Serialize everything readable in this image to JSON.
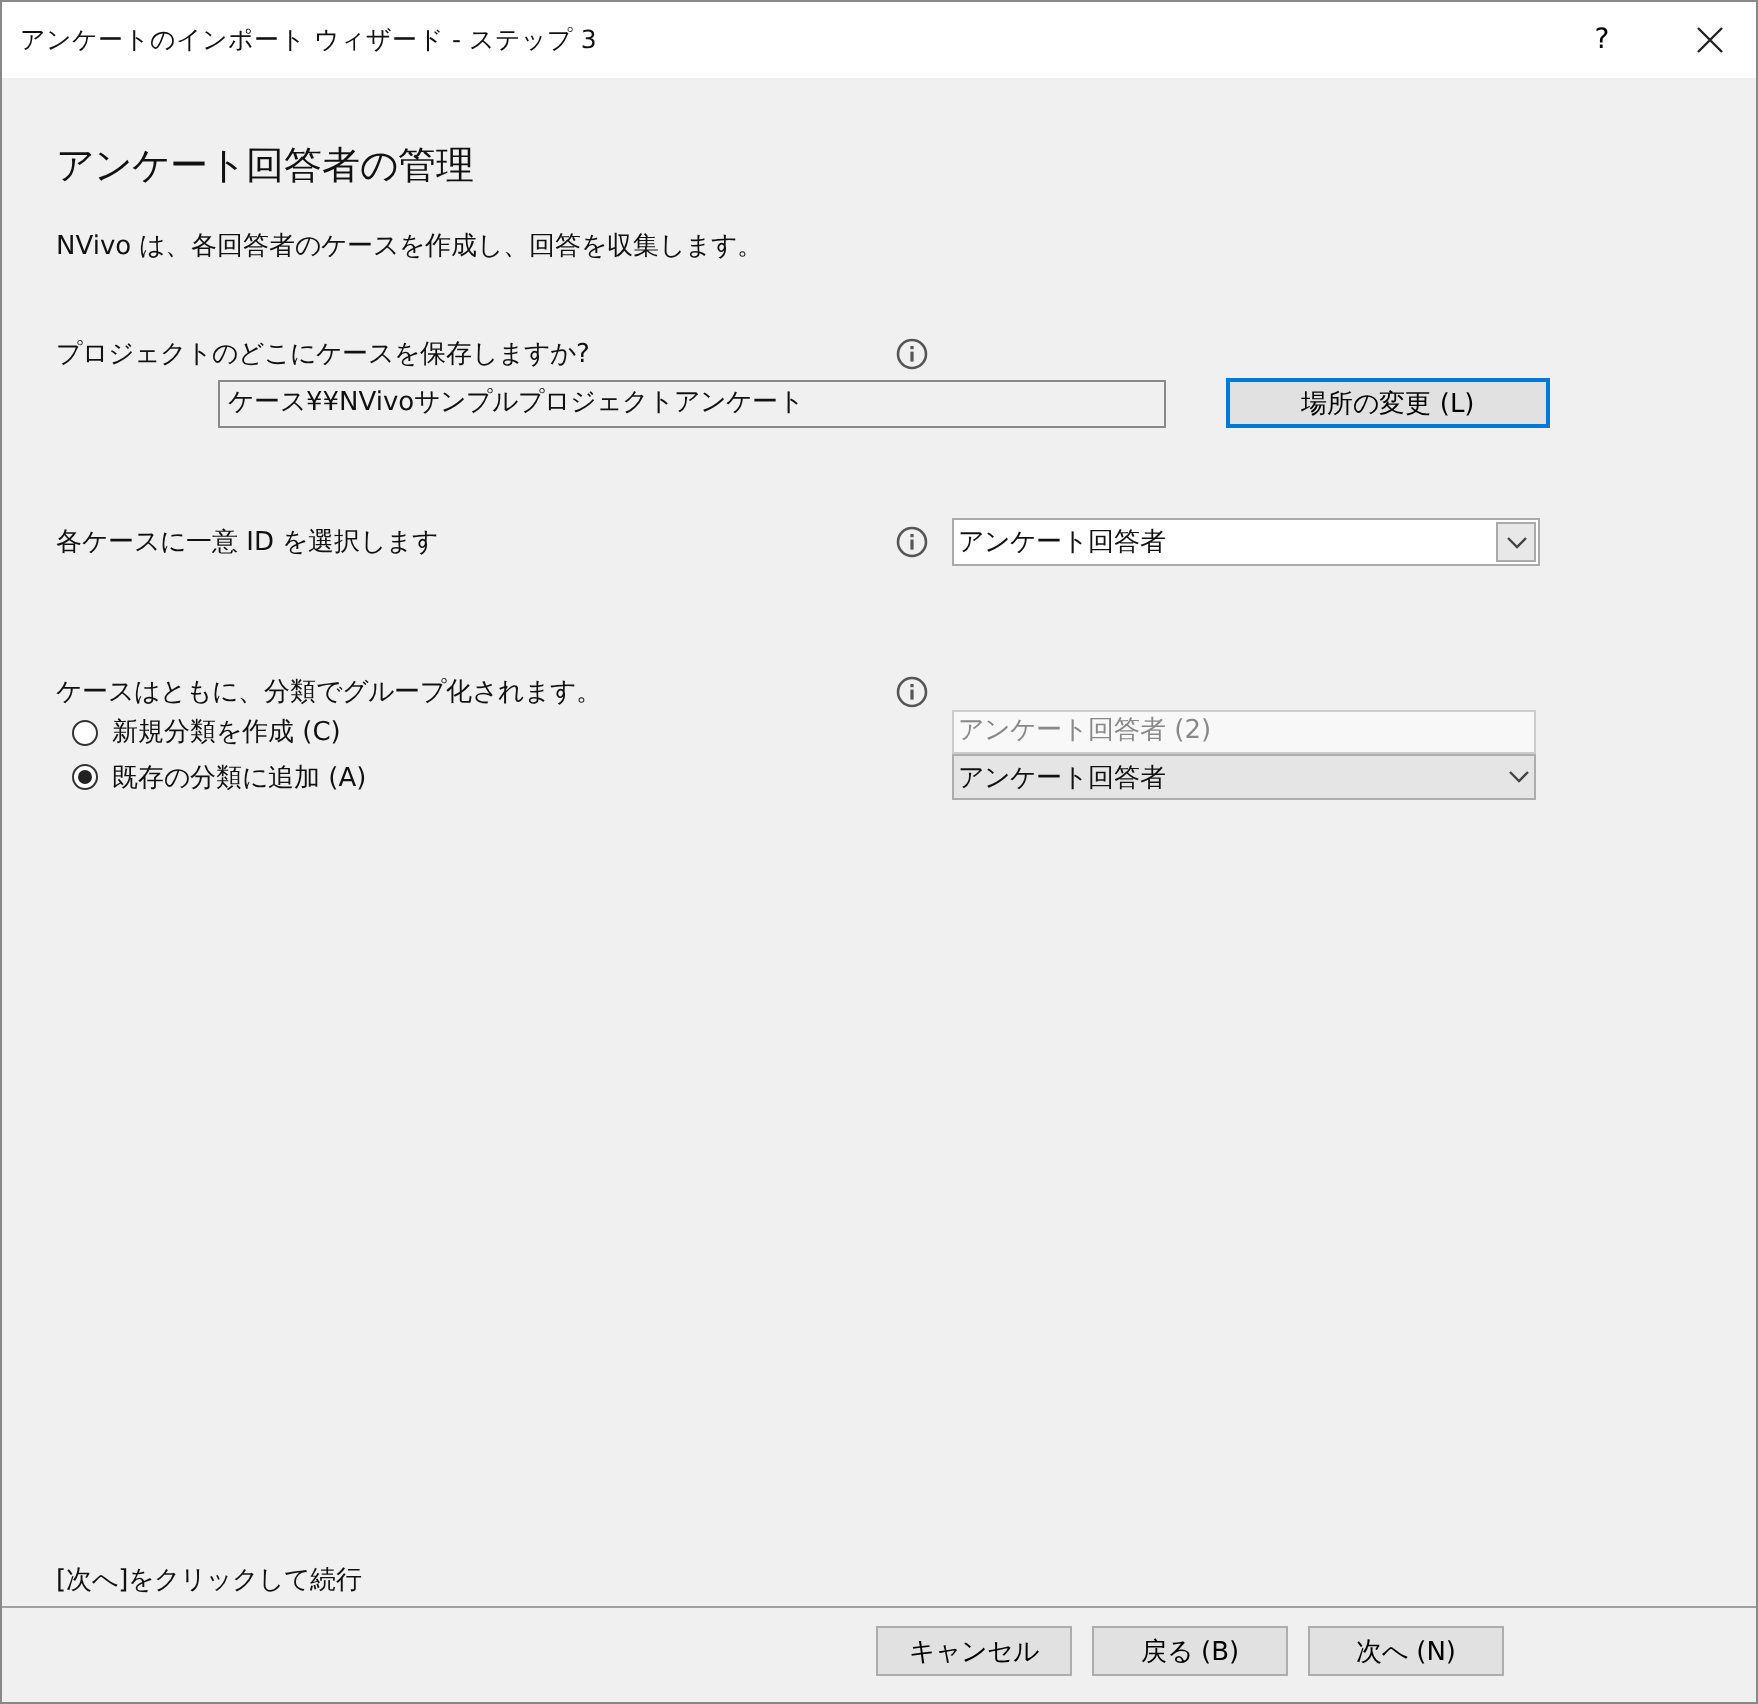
{
  "window": {
    "title": "アンケートのインポート ウィザード - ステップ 3",
    "help": "?"
  },
  "heading": "アンケート回答者の管理",
  "description": "NVivo は、各回答者のケースを作成し、回答を収集します。",
  "location": {
    "label": "プロジェクトのどこにケースを保存しますか?",
    "value": "ケース¥¥NVivoサンプルプロジェクトアンケート",
    "button": "場所の変更 (L)"
  },
  "unique_id": {
    "label": "各ケースに一意 ID を選択します",
    "value": "アンケート回答者"
  },
  "classification": {
    "label": "ケースはともに、分類でグループ化されます。",
    "options": [
      {
        "label": "新規分類を作成 (C)",
        "selected": false,
        "kind": "field",
        "value": "アンケート回答者 (2)",
        "disabled": true
      },
      {
        "label": "既存の分類に追加 (A)",
        "selected": true,
        "kind": "dropdown",
        "value": "アンケート回答者",
        "disabled": false
      }
    ]
  },
  "hint": "[次へ]をクリックして続行",
  "buttons": [
    "キャンセル",
    "戻る (B)",
    "次へ (N)"
  ]
}
